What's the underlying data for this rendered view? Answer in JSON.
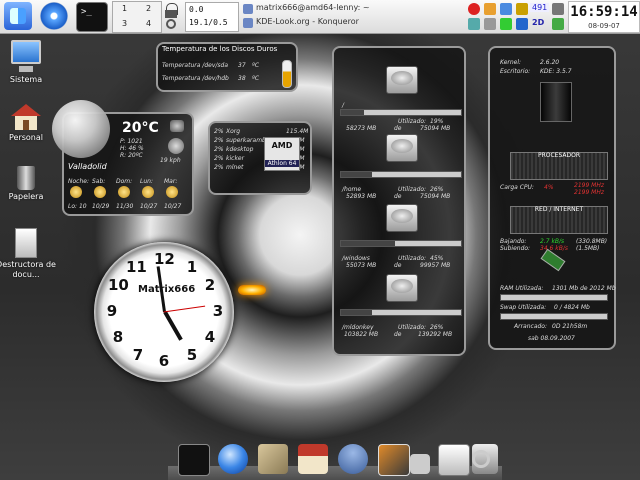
{
  "top_panel": {
    "console_label": ">_",
    "pager": [
      "1",
      "2",
      "3",
      "4"
    ],
    "net": {
      "line1": "0.0",
      "line2": "19.1/0.5"
    },
    "tasks": [
      {
        "label": "matrix666@amd64-lenny: ~"
      },
      {
        "label": "KDE-Look.org - Konqueror"
      }
    ],
    "tray_count": "491",
    "tray_label2": "2D",
    "clock": {
      "time": "16:59:14",
      "date": "08-09-07"
    }
  },
  "desktop_icons": {
    "system": "Sistema",
    "personal": "Personal",
    "trash": "Papelera",
    "shredder": "Destructora de docu..."
  },
  "hdd_temp": {
    "title": "Temperatura de los Discos Duros",
    "rows": [
      {
        "label": "Temperatura /dev/sda",
        "value": "37",
        "unit": "ºC"
      },
      {
        "label": "Temperatura /dev/hdb",
        "value": "38",
        "unit": "ºC"
      }
    ]
  },
  "weather": {
    "temp": "20°C",
    "pressure": "P: 1021",
    "humidity": "H: 46 %",
    "realfeel": "R: 20ºC",
    "wind": "19 kph",
    "city": "Valladolid",
    "days": [
      "Noche:",
      "Sab:",
      "Dom:",
      "Lun:",
      "Mar:"
    ],
    "forecast": [
      "Lo: 10",
      "10/29",
      "11/30",
      "10/27",
      "10/27"
    ]
  },
  "processes": [
    {
      "pct": "2%",
      "name": "Xorg",
      "mem": "115.4M"
    },
    {
      "pct": "2%",
      "name": "superkaramba",
      "mem": "44.8M"
    },
    {
      "pct": "2%",
      "name": "kdesktop",
      "mem": "41.9M"
    },
    {
      "pct": "2%",
      "name": "kicker",
      "mem": "36.2M"
    },
    {
      "pct": "2%",
      "name": "mlnet",
      "mem": "31.8M"
    }
  ],
  "amd_chip": {
    "brand": "AMD",
    "model": "Athlon 64"
  },
  "disks": [
    {
      "mount": "/",
      "used_label": "Utilizado:",
      "pct": "19%",
      "used": "58273 MB",
      "de": "de",
      "total": "75094 MB",
      "fill": 0.19
    },
    {
      "mount": "/home",
      "used_label": "Utilizado:",
      "pct": "26%",
      "used": "52893 MB",
      "de": "de",
      "total": "75094 MB",
      "fill": 0.26
    },
    {
      "mount": "/windows",
      "used_label": "Utilizado:",
      "pct": "45%",
      "used": "55073 MB",
      "de": "de",
      "total": "99957 MB",
      "fill": 0.45
    },
    {
      "mount": "/mldonkey",
      "used_label": "Utilizado:",
      "pct": "26%",
      "used": "103822 MB",
      "de": "de",
      "total": "139292 MB",
      "fill": 0.26
    }
  ],
  "system": {
    "kernel_label": "Kernel:",
    "kernel": "2.6.20",
    "desktop_label": "Escritorio:",
    "desktop": "KDE: 3.5.7",
    "cpu_title": "PROCESADOR",
    "cpu_load_label": "Carga CPU:",
    "cpu_load": "4%",
    "cpu_mhz1": "2199 MHz",
    "cpu_mhz2": "2199 MHz",
    "net_title": "RED / INTERNET",
    "down_label": "Bajando:",
    "down_speed": "2.7 kB/s",
    "down_total": "(330.8MB)",
    "up_label": "Subiendo:",
    "up_speed": "34.6 kB/s",
    "up_total": "(1.5MB)",
    "ram_label": "RAM Utilizada:",
    "ram": "1301 Mb de 2012 Mb",
    "swap_label": "Swap Utilizada:",
    "swap": "0 / 4824 Mb",
    "uptime_label": "Arrancado:",
    "uptime": "0D  21h58m",
    "date": "sab 08.09.2007",
    "colors": {
      "green": "#2fd62f",
      "red": "#e03232",
      "yellow": "#e8d84a"
    }
  },
  "analog_clock": {
    "label": "Matrix666",
    "numbers": [
      "12",
      "1",
      "2",
      "3",
      "4",
      "5",
      "6",
      "7",
      "8",
      "9",
      "10",
      "11"
    ]
  },
  "dock": [
    "terminal-icon",
    "network-globe-icon",
    "mail-stamp-icon",
    "home-icon",
    "users-icon",
    "photo-icon",
    "media-player-icon",
    "linux-penguin-icon",
    "settings-icon",
    "search-magnifier-icon"
  ]
}
